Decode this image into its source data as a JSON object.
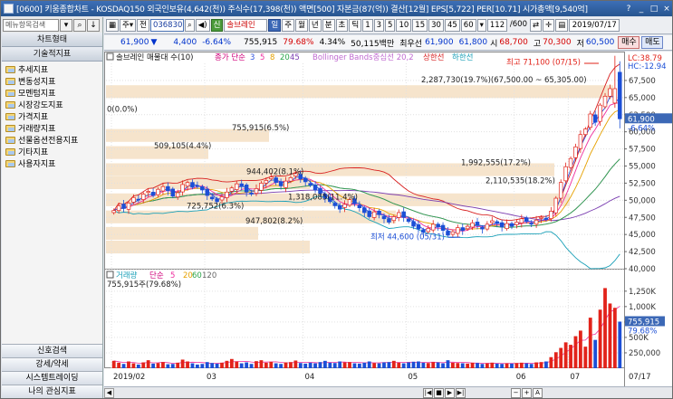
{
  "window": {
    "title": "[0600] 키움종합차트 - KOSDAQ150 외국인보유(4,642(천)) 주식수(17,398(천)) 액면[500] 자본금(87(억)) 결산[12월] EPS[5,722] PER[10.71] 시가총액[9,540억]"
  },
  "sidebar": {
    "search_placeholder": "메뉴항목검색",
    "header_chart_type": "차트형태",
    "header_indicators": "기술적지표",
    "items": [
      "추세지표",
      "변동성지표",
      "모멘텀지표",
      "시장강도지표",
      "가격지표",
      "거래량지표",
      "선물옵션전용지표",
      "기타지표",
      "사용자지표"
    ],
    "bottom": [
      "신호검색",
      "강세/약세",
      "시스템트레이딩",
      "나의 관심지표"
    ]
  },
  "toolbar": {
    "stock_code": "036830",
    "stock_name": "솔브레인",
    "prev_label": "전",
    "periods": [
      "일",
      "주",
      "월",
      "년",
      "분",
      "초",
      "틱"
    ],
    "minutes": [
      "1",
      "3",
      "5",
      "10",
      "15",
      "30",
      "45",
      "60"
    ],
    "count": "112",
    "count_total": "/600",
    "date": "2019/07/17"
  },
  "quote": {
    "price": "61,900",
    "arrow": "▼",
    "change": "4,400",
    "change_pct": "-6.64%",
    "volume": "755,915",
    "vol_ratio": "79.68%",
    "turnover": "4.34%",
    "amount": "50,115백만",
    "best_label": "최우선",
    "best_bid": "61,900",
    "best_ask": "61,800",
    "open_label": "시",
    "open": "68,700",
    "high_label": "고",
    "high": "70,300",
    "low_label": "저",
    "low": "60,500",
    "buy_label": "매수",
    "sell_label": "매도"
  },
  "chart_data": [
    {
      "type": "candlestick",
      "legend": "솔브레인 매물대 수(10)",
      "ma_legend": [
        "종가 단순",
        "3",
        "5",
        "8",
        "20",
        "45"
      ],
      "bb_legend": "Bollinger Bands중심선 20,2",
      "bb_upper": "상한선",
      "bb_lower": "하한선",
      "ylim": [
        40000,
        70000
      ],
      "y_ticks": [
        "67,500",
        "65,000",
        "62,500",
        "60,000",
        "57,500",
        "55,000",
        "52,500",
        "50,000",
        "47,500",
        "45,000",
        "42,500",
        "40,000"
      ],
      "current_price_label": "61,900",
      "current_pct_label": "-6.64%",
      "lc_label": "LC:38.79",
      "hc_label": "HC:-12.94",
      "max_annotation": "최고 71,100 (07/15)",
      "min_annotation": "최저 44,600 (05/31)",
      "volume_profile_labels": [
        "2,287,730(19.7%)(67,500.00 ~ 65,305.00)",
        "0(0.0%)",
        "755,915(6.5%)",
        "509,105(4.4%)",
        "1,992,555(17.2%)",
        "944,402(8.1%)",
        "2,110,535(18.2%)",
        "1,318,085(11.4%)",
        "725,752(6.3%)",
        "947,802(8.2%)"
      ],
      "closes": [
        48500,
        49200,
        48800,
        49600,
        50400,
        50100,
        50900,
        51300,
        50700,
        51600,
        52000,
        51400,
        50600,
        51100,
        52300,
        52600,
        51900,
        52100,
        51500,
        50700,
        50200,
        49800,
        50500,
        51200,
        51800,
        52400,
        52000,
        51200,
        50900,
        51700,
        52500,
        52900,
        53400,
        52600,
        52100,
        52800,
        53300,
        53900,
        53100,
        52700,
        52200,
        51500,
        51000,
        50300,
        49800,
        49200,
        48700,
        49400,
        50100,
        49500,
        48900,
        48200,
        47600,
        48300,
        47900,
        47300,
        46800,
        47600,
        48200,
        47500,
        46900,
        46200,
        45800,
        45300,
        45900,
        46500,
        46100,
        45600,
        44900,
        45400,
        46000,
        45600,
        46200,
        46700,
        46300,
        45800,
        46500,
        47000,
        46600,
        46100,
        46600,
        46200,
        46800,
        47300,
        46900,
        46500,
        47100,
        47500,
        47200,
        48400,
        50300,
        52600,
        54900,
        56100,
        57800,
        59600,
        60400,
        62600,
        61400,
        63900,
        65200,
        66300,
        63900,
        61900
      ],
      "volume_ylim": [
        0,
        1350000
      ],
      "volume_ticks": [
        "1,250K",
        "1,000K",
        "750K",
        "500K",
        "250,000"
      ],
      "volume_legend": "거래량",
      "volume_ma_legend": [
        "단순",
        "5",
        "20",
        "60",
        "120"
      ],
      "volume_current": "755,915주(79.68%)",
      "volume_axis_current": "755,915",
      "volume_axis_pct": "79.68%",
      "volumes": [
        120000,
        90000,
        70000,
        110000,
        80000,
        60000,
        95000,
        130000,
        75000,
        85000,
        100000,
        65000,
        70000,
        90000,
        140000,
        110000,
        80000,
        60000,
        70000,
        100000,
        85000,
        75000,
        90000,
        120000,
        150000,
        110000,
        80000,
        95000,
        70000,
        115000,
        130000,
        90000,
        105000,
        80000,
        70000,
        95000,
        100000,
        125000,
        85000,
        75000,
        90000,
        80000,
        100000,
        120000,
        90000,
        85000,
        110000,
        95000,
        100000,
        80000,
        75000,
        90000,
        110000,
        85000,
        80000,
        95000,
        100000,
        120000,
        90000,
        80000,
        95000,
        105000,
        110000,
        90000,
        85000,
        100000,
        95000,
        80000,
        130000,
        90000,
        85000,
        80000,
        75000,
        90000,
        85000,
        70000,
        80000,
        90000,
        75000,
        70000,
        80000,
        75000,
        85000,
        90000,
        80000,
        70000,
        95000,
        100000,
        110000,
        180000,
        260000,
        330000,
        420000,
        380000,
        520000,
        610000,
        350000,
        820000,
        460000,
        950000,
        1300000,
        1050000,
        980000,
        755915
      ],
      "x_labels": [
        "2019/02",
        "03",
        "04",
        "05",
        "06",
        "07"
      ],
      "x_right_label": "07/17"
    }
  ],
  "colors": {
    "up": "#e2231a",
    "down": "#1c4fd6",
    "accent": "#3c68b6"
  }
}
